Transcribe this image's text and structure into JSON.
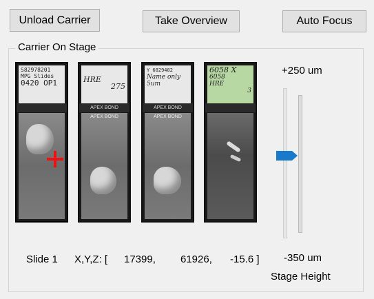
{
  "toolbar": {
    "unload_label": "Unload Carrier",
    "overview_label": "Take Overview",
    "autofocus_label": "Auto Focus"
  },
  "carrier": {
    "title": "Carrier On Stage",
    "slides": [
      {
        "label_lines": [
          "S82978201",
          "MPG Slides",
          "0420 OP1"
        ],
        "strip": ""
      },
      {
        "label_lines": [
          "HRE",
          "275"
        ],
        "strip": "APEX BOND",
        "glass_strip": "APEX BOND"
      },
      {
        "label_lines": [
          "Y 6829482",
          "Name only",
          "5um"
        ],
        "strip": "APEX BOND",
        "glass_strip": "APEX BOND"
      },
      {
        "label_lines": [
          "6058 X",
          "6058",
          "HRE",
          "3"
        ],
        "strip": ""
      }
    ]
  },
  "readout": {
    "slide": "Slide 1",
    "xyz_label": "X,Y,Z: [",
    "x": "17399,",
    "y": "61926,",
    "z": "-15.6 ]"
  },
  "stage": {
    "top_label": "+250 um",
    "bottom_label": "-350 um",
    "caption": "Stage Height",
    "thumb_color": "#1979ca"
  },
  "colors": {
    "crosshair": "#ee1111",
    "window_bg": "#f0f0f0"
  }
}
